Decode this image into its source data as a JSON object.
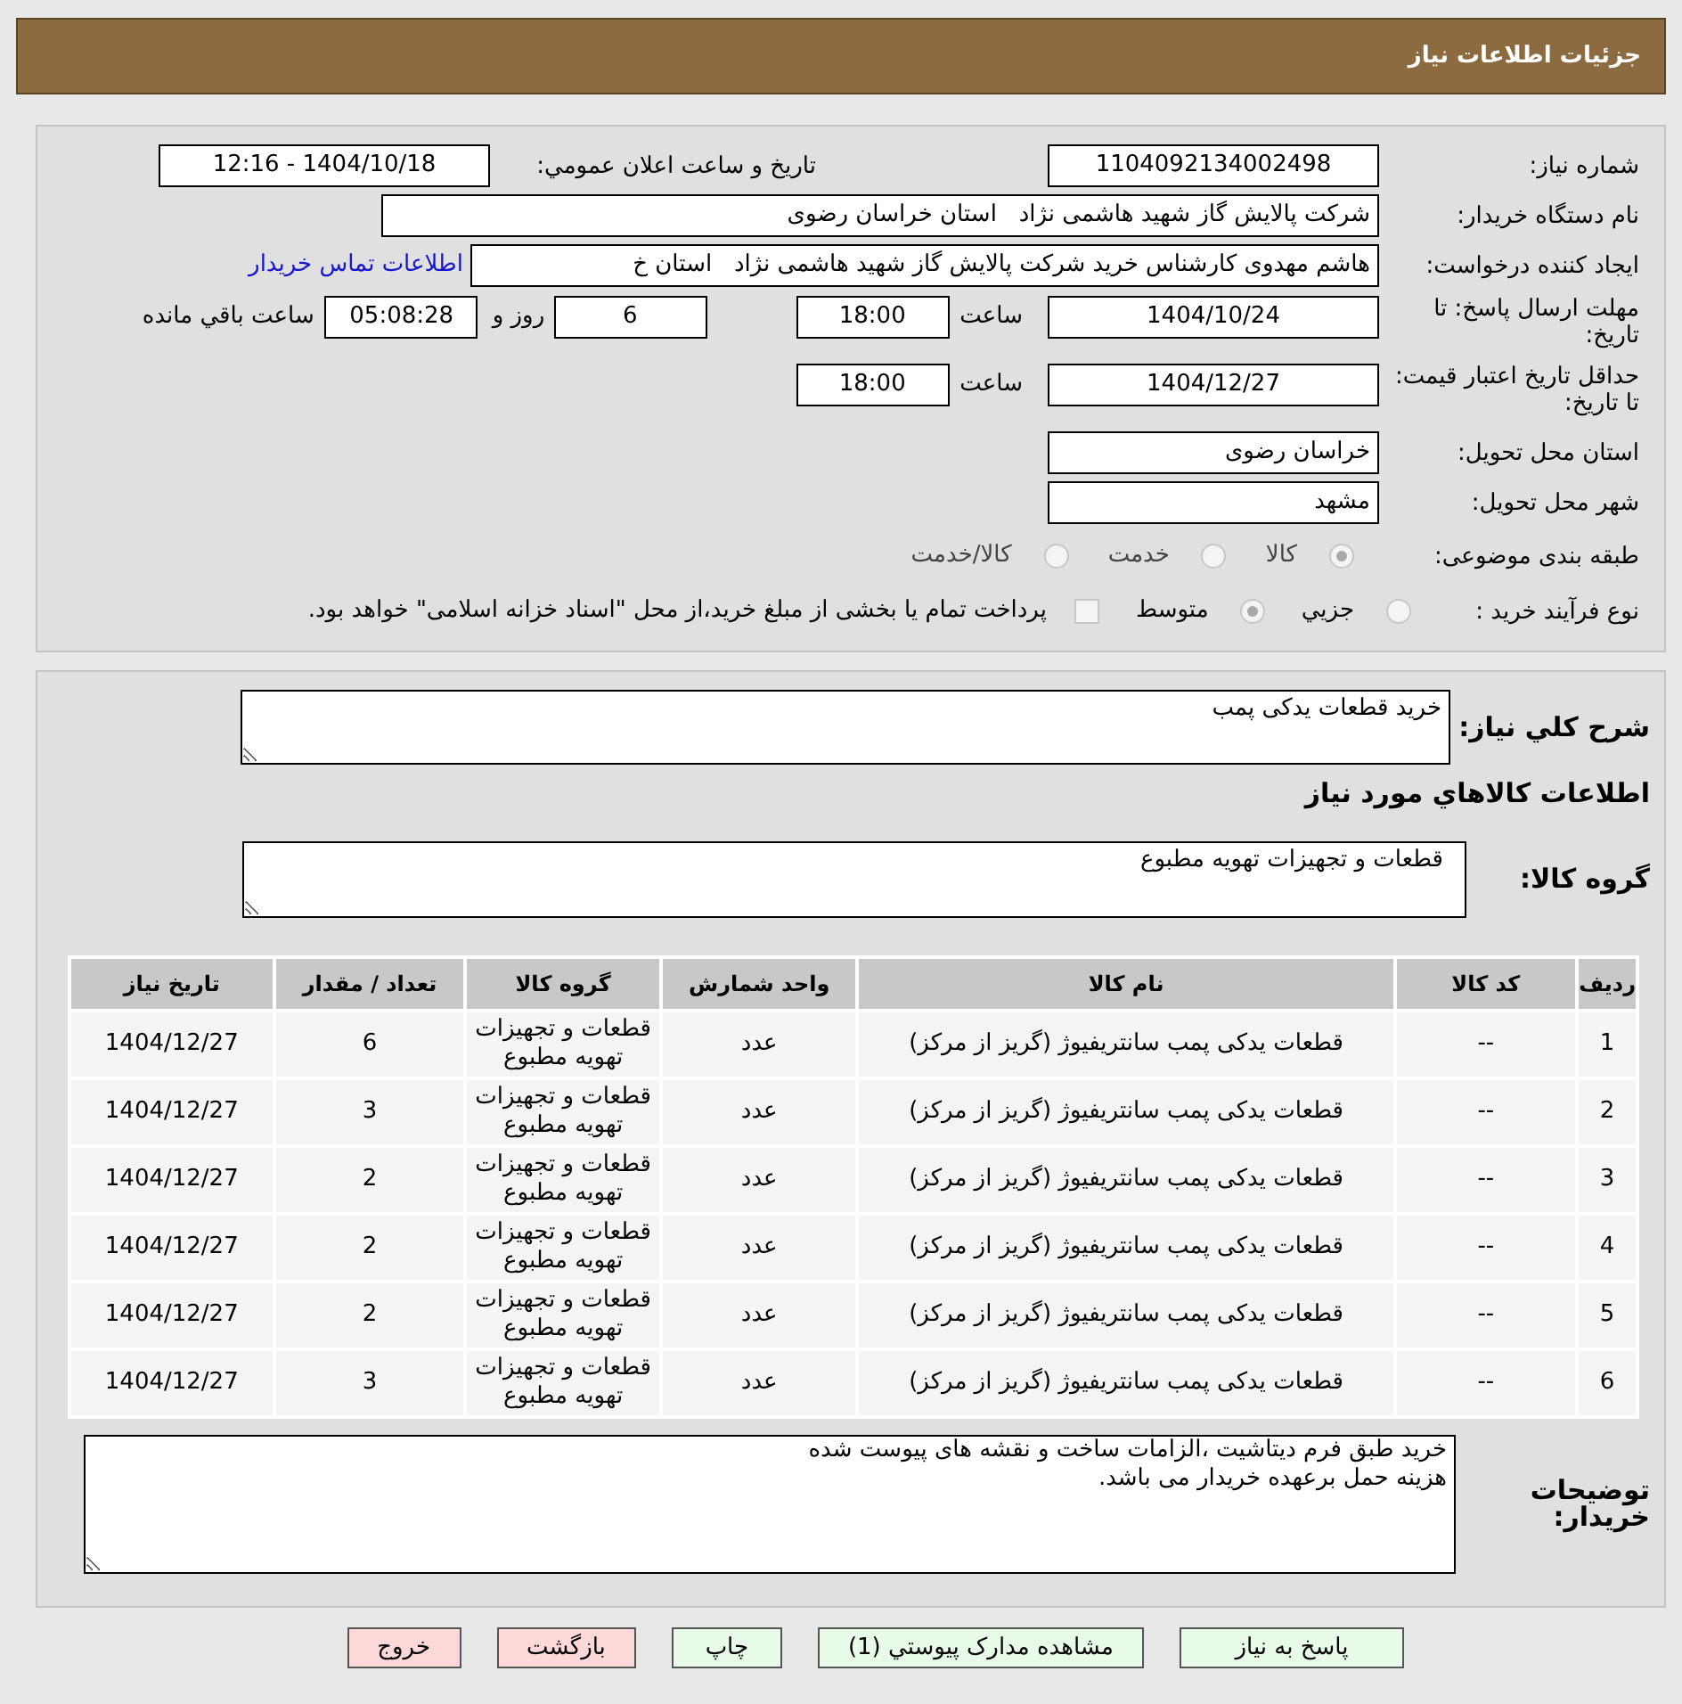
{
  "header": {
    "title": "جزئیات اطلاعات نیاز"
  },
  "need_number": {
    "label": "شماره نیاز:",
    "value": "1104092134002498"
  },
  "announce": {
    "label": "تاریخ و ساعت اعلان عمومي:",
    "value": "1404/10/18 - 12:16"
  },
  "buyer": {
    "label": "نام دستگاه خریدار:",
    "value": "شرکت پالایش گاز شهید هاشمی نژاد   استان خراسان رضوی"
  },
  "requester": {
    "label": "ایجاد کننده درخواست:",
    "value": "هاشم مهدوی کارشناس خرید شرکت پالایش گاز شهید هاشمی نژاد   استان خ",
    "link": "اطلاعات تماس خریدار"
  },
  "deadline": {
    "label": "مهلت ارسال پاسخ: تا تاریخ:",
    "date": "1404/10/24",
    "time_label": "ساعت",
    "time": "18:00",
    "days": "6",
    "days_label": "روز و",
    "remaining": "05:08:28",
    "remaining_label": "ساعت باقي مانده"
  },
  "validity": {
    "label": "حداقل تاریخ اعتبار قیمت: تا تاریخ:",
    "date": "1404/12/27",
    "time_label": "ساعت",
    "time": "18:00"
  },
  "province": {
    "label": "استان محل تحویل:",
    "value": "خراسان رضوی"
  },
  "city": {
    "label": "شهر محل تحویل:",
    "value": "مشهد"
  },
  "category": {
    "label": "طبقه بندی موضوعی:",
    "options": [
      {
        "label": "کالا",
        "selected": true
      },
      {
        "label": "خدمت",
        "selected": false
      },
      {
        "label": "کالا/خدمت",
        "selected": false
      }
    ]
  },
  "process": {
    "label": "نوع فرآیند خرید :",
    "options": [
      {
        "label": "جزيي",
        "selected": false
      },
      {
        "label": "متوسط",
        "selected": true
      }
    ],
    "treasury": {
      "checked": false,
      "label": "پرداخت تمام یا بخشی از مبلغ خرید،از محل \"اسناد خزانه اسلامی\" خواهد بود."
    }
  },
  "description": {
    "label": "شرح کلي نیاز:",
    "value": "خرید قطعات یدکی پمب"
  },
  "goods_heading": "اطلاعات کالاهاي مورد نیاز",
  "goods_group": {
    "label": "گروه کالا:",
    "value": "قطعات و تجهیزات تهویه مطبوع"
  },
  "table": {
    "columns": [
      "ردیف",
      "کد کالا",
      "نام کالا",
      "واحد شمارش",
      "گروه کالا",
      "تعداد / مقدار",
      "تاریخ نیاز"
    ],
    "rows": [
      [
        "1",
        "--",
        "قطعات یدکی پمب سانتریفیوژ (گریز از مرکز)",
        "عدد",
        "قطعات و تجهیزات تهویه مطبوع",
        "6",
        "1404/12/27"
      ],
      [
        "2",
        "--",
        "قطعات یدکی پمب سانتریفیوژ (گریز از مرکز)",
        "عدد",
        "قطعات و تجهیزات تهویه مطبوع",
        "3",
        "1404/12/27"
      ],
      [
        "3",
        "--",
        "قطعات یدکی پمب سانتریفیوژ (گریز از مرکز)",
        "عدد",
        "قطعات و تجهیزات تهویه مطبوع",
        "2",
        "1404/12/27"
      ],
      [
        "4",
        "--",
        "قطعات یدکی پمب سانتریفیوژ (گریز از مرکز)",
        "عدد",
        "قطعات و تجهیزات تهویه مطبوع",
        "2",
        "1404/12/27"
      ],
      [
        "5",
        "--",
        "قطعات یدکی پمب سانتریفیوژ (گریز از مرکز)",
        "عدد",
        "قطعات و تجهیزات تهویه مطبوع",
        "2",
        "1404/12/27"
      ],
      [
        "6",
        "--",
        "قطعات یدکی پمب سانتریفیوژ (گریز از مرکز)",
        "عدد",
        "قطعات و تجهیزات تهویه مطبوع",
        "3",
        "1404/12/27"
      ]
    ]
  },
  "notes": {
    "label": "توضیحات خریدار:",
    "value": "خرید طبق فرم دیتاشیت ،الزامات ساخت و نقشه های پیوست شده\nهزینه حمل برعهده خریدار می باشد."
  },
  "buttons": [
    {
      "label": "پاسخ به نیاز",
      "kind": "normal"
    },
    {
      "label": "مشاهده مدارک پیوستي (1)",
      "kind": "normal"
    },
    {
      "label": "چاپ",
      "kind": "normal"
    },
    {
      "label": "بازگشت",
      "kind": "danger"
    },
    {
      "label": "خروج",
      "kind": "danger"
    }
  ]
}
